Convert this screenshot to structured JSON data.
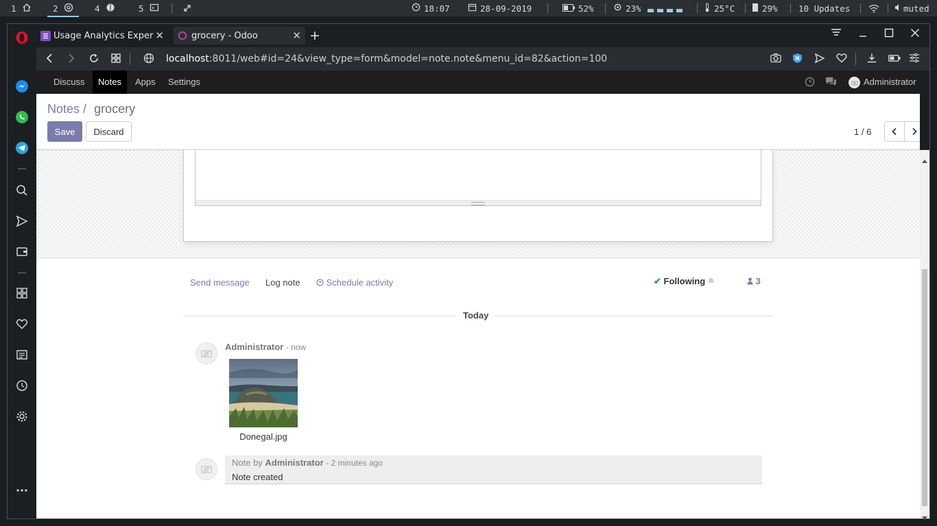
{
  "statusbar": {
    "workspaces": [
      {
        "num": "1",
        "icon": "home-icon"
      },
      {
        "num": "2",
        "icon": "chrome-icon"
      },
      {
        "num": "4",
        "icon": "brain-icon"
      },
      {
        "num": "5",
        "icon": "terminal-icon"
      }
    ],
    "time": "18:07",
    "date": "28-09-2019",
    "battery": "52%",
    "cpu": "23%",
    "temperature": "25°C",
    "memory": "29%",
    "updates": "10 Updates",
    "volume": "muted"
  },
  "browser": {
    "tabs": [
      {
        "title": "Usage Analytics Exper",
        "icon": "list-icon"
      },
      {
        "title": "grocery - Odoo",
        "icon": "odoo-icon"
      }
    ],
    "url_host": "localhost",
    "url_rest": ":8011/web#id=24&view_type=form&model=note.note&menu_id=82&action=100"
  },
  "odoo": {
    "menu": [
      "Discuss",
      "Notes",
      "Apps",
      "Settings"
    ],
    "user": "Administrator",
    "breadcrumb_parent": "Notes",
    "breadcrumb_sep": "/",
    "breadcrumb_current": "grocery",
    "save": "Save",
    "discard": "Discard",
    "pager": "1 / 6"
  },
  "chatter": {
    "send_message": "Send message",
    "log_note": "Log note",
    "schedule_activity": "Schedule activity",
    "following": "Following",
    "followers_count": "3",
    "today": "Today",
    "message1": {
      "author": "Administrator",
      "date": "- now",
      "attachment": "Donegal.jpg"
    },
    "message2": {
      "prefix": "Note by",
      "author": "Administrator",
      "date": "- 2 minutes ago",
      "body": "Note created"
    }
  },
  "colors": {
    "odoo_primary": "#7c7bad",
    "odoo_nav_bg": "#1e1e1e",
    "following_check": "#28a745"
  }
}
